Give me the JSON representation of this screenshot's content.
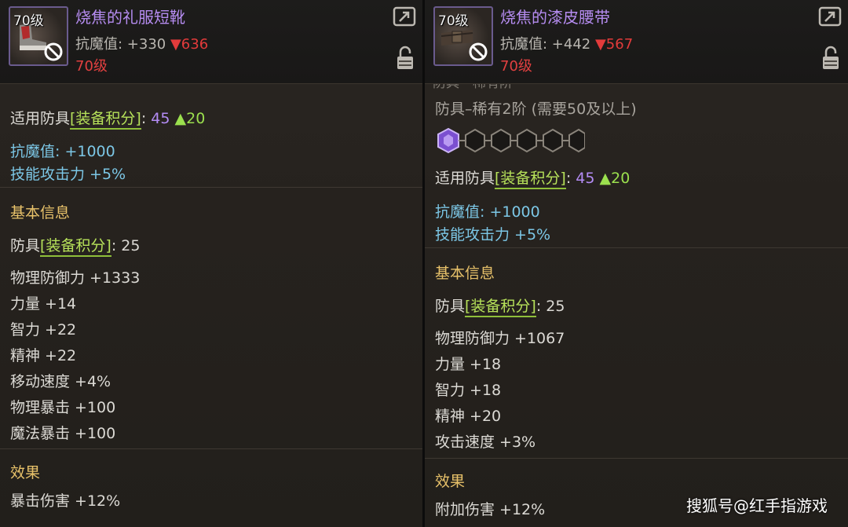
{
  "left": {
    "level_tag": "70级",
    "title": "烧焦的礼服短靴",
    "resist_label": "抗魔值: +330",
    "resist_down": "▼636",
    "req_level": "70级",
    "fit_prefix": "适用防具",
    "fit_tag": "[装备积分]",
    "fit_colon": ":",
    "fit_score": "45",
    "fit_up": "▲20",
    "bonus1": "抗魔值: +1000",
    "bonus2": "技能攻击力 +5%",
    "section_basic": "基本信息",
    "armor_prefix": "防具",
    "armor_tag": "[装备积分]",
    "armor_value": ": 25",
    "stats": [
      "物理防御力 +1333",
      "力量 +14",
      "智力 +22",
      "精神 +22",
      "移动速度 +4%",
      "物理暴击 +100",
      "魔法暴击 +100"
    ],
    "section_effect": "效果",
    "effect": "暴击伤害 +12%"
  },
  "right": {
    "level_tag": "70级",
    "title": "烧焦的漆皮腰带",
    "resist_label": "抗魔值: +442",
    "resist_down": "▼567",
    "req_level": "70级",
    "cutoff_text": "防具－稀有阶",
    "grade_text": "防具–稀有2阶 (需要50及以上)",
    "fit_prefix": "适用防具",
    "fit_tag": "[装备积分]",
    "fit_colon": ":",
    "fit_score": "45",
    "fit_up": "▲20",
    "bonus1": "抗魔值: +1000",
    "bonus2": "技能攻击力 +5%",
    "section_basic": "基本信息",
    "armor_prefix": "防具",
    "armor_tag": "[装备积分]",
    "armor_value": ": 25",
    "stats": [
      "物理防御力 +1067",
      "力量 +18",
      "智力 +18",
      "精神 +20",
      "攻击速度 +3%"
    ],
    "section_effect": "效果",
    "effect": "附加伤害 +12%"
  },
  "watermark": "搜狐号@红手指游戏",
  "colors": {
    "title_purple": "#b58cf0",
    "down_red": "#e33b3b",
    "tag_green": "#b7e25a",
    "bonus_blue": "#7cc7e6",
    "section_gold": "#e8c26a"
  },
  "icons": [
    "item-icon",
    "forbidden-icon",
    "share-icon",
    "lock-icon",
    "gem-socket-icon"
  ]
}
